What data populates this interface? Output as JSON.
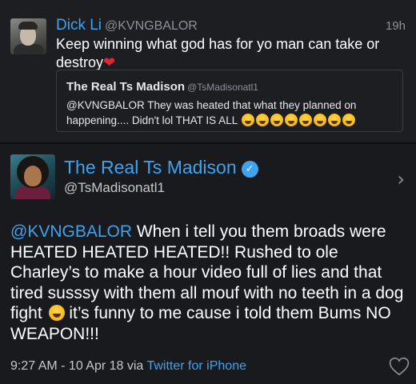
{
  "quoting_tweet": {
    "author_name": "Dick Li",
    "author_handle": "@KVNGBALOR",
    "time": "19h",
    "text": "Keep winning what god has for yo man can take or destroy",
    "emoji": "heart-emoji",
    "quoted": {
      "author_name": "The Real Ts Madison",
      "author_handle": "@TsMadisonatl1",
      "text": "@KVNGBALOR They was heated that what they planned on happening.... Didn't lol THAT IS ALL",
      "laugh_count": 8
    }
  },
  "main_tweet": {
    "author_name": "The Real Ts Madison",
    "author_handle": "@TsMadisonatl1",
    "verified": true,
    "mention": "@KVNGBALOR",
    "text_part1": " When i tell you them broads were HEATED HEATED HEATED!! Rushed to ole Charley’s to make a hour video full of lies and that tired susssy with them all mouf with no teeth in a dog fight ",
    "text_part2": " it’s funny to me cause i told them Bums NO WEAPON!!!",
    "timestamp": "9:27 AM - 10 Apr 18 via ",
    "source": "Twitter for iPhone"
  },
  "colors": {
    "link": "#3fa3f0",
    "background": "#181a1d",
    "secondary_text": "#8c9199"
  },
  "icons": [
    "heart-emoji",
    "laughing-emoji",
    "verified-badge-icon",
    "chevron-right-icon",
    "like-heart-icon"
  ]
}
